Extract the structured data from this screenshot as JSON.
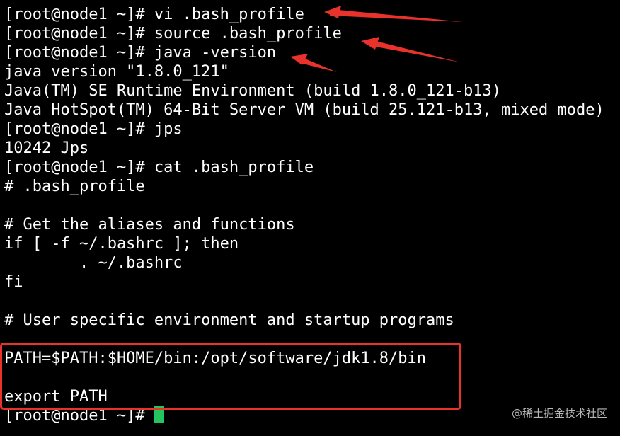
{
  "terminal": {
    "lines": [
      "[root@node1 ~]# vi .bash_profile",
      "[root@node1 ~]# source .bash_profile",
      "[root@node1 ~]# java -version",
      "java version \"1.8.0_121\"",
      "Java(TM) SE Runtime Environment (build 1.8.0_121-b13)",
      "Java HotSpot(TM) 64-Bit Server VM (build 25.121-b13, mixed mode)",
      "[root@node1 ~]# jps",
      "10242 Jps",
      "[root@node1 ~]# cat .bash_profile",
      "# .bash_profile",
      "",
      "# Get the aliases and functions",
      "if [ -f ~/.bashrc ]; then",
      "        . ~/.bashrc",
      "fi",
      "",
      "# User specific environment and startup programs",
      "",
      "PATH=$PATH:$HOME/bin:/opt/software/jdk1.8/bin",
      "",
      "export PATH",
      "[root@node1 ~]# "
    ],
    "cursor_color": "#22c55e",
    "annotation_color": "#e8322b"
  },
  "watermark": "@稀土掘金技术社区"
}
